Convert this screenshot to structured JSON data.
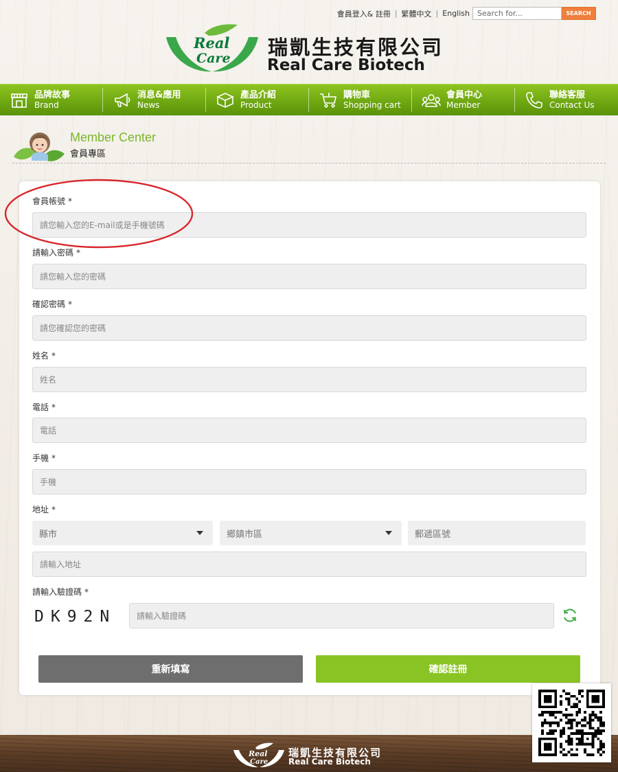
{
  "topbar": {
    "login": "會員登入& 註冊",
    "lang_zh": "繁體中文",
    "lang_en": "English",
    "search_placeholder": "Search for...",
    "search_button": "SEARCH"
  },
  "logo": {
    "mark_line1": "Real",
    "mark_line2": "Care",
    "name_cn": "瑞凱生技有限公司",
    "name_en": "Real Care Biotech"
  },
  "nav": {
    "items": [
      {
        "cn": "品牌故事",
        "en": "Brand",
        "icon": "storefront-icon"
      },
      {
        "cn": "消息&應用",
        "en": "News",
        "icon": "megaphone-icon"
      },
      {
        "cn": "產品介紹",
        "en": "Product",
        "icon": "box-icon"
      },
      {
        "cn": "購物車",
        "en": "Shopping cart",
        "icon": "cart-icon"
      },
      {
        "cn": "會員中心",
        "en": "Member",
        "icon": "members-icon"
      },
      {
        "cn": "聯絡客服",
        "en": "Contact Us",
        "icon": "phone-icon"
      }
    ]
  },
  "section": {
    "title_en": "Member Center",
    "title_cn": "會員專區"
  },
  "form": {
    "account": {
      "label": "會員帳號",
      "required": "*",
      "placeholder": "請您輸入您的E-mail或是手機號碼"
    },
    "password": {
      "label": "請輸入密碼",
      "required": "*",
      "placeholder": "請您輸入您的密碼"
    },
    "confirm": {
      "label": "確認密碼",
      "required": "*",
      "placeholder": "請您確認您的密碼"
    },
    "name": {
      "label": "姓名",
      "required": "*",
      "placeholder": "姓名"
    },
    "phone": {
      "label": "電話",
      "required": "*",
      "placeholder": "電話"
    },
    "mobile": {
      "label": "手機",
      "required": "*",
      "placeholder": "手機"
    },
    "address": {
      "label": "地址",
      "required": "*",
      "city": "縣市",
      "district": "鄉鎮市區",
      "zip": "郵遞區號",
      "placeholder": "請輸入地址"
    },
    "captcha": {
      "label": "請輸入驗證碼",
      "required": "*",
      "code": "DK92N",
      "placeholder": "請輸入驗證碼"
    },
    "reset_button": "重新填寫",
    "submit_button": "確認註冊"
  },
  "footer": {
    "name_cn": "瑞凱生技有限公司",
    "name_en": "Real Care Biotech"
  },
  "colors": {
    "brand_green": "#8ac424",
    "nav_green": "#6fa812",
    "search_orange": "#f07f3c",
    "annotation_red": "#d9262c"
  }
}
